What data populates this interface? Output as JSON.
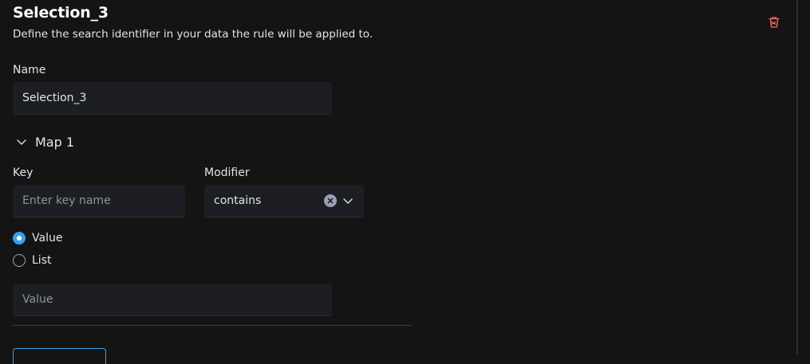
{
  "header": {
    "title": "Selection_3",
    "description": "Define the search identifier in your data the rule will be applied to."
  },
  "name_field": {
    "label": "Name",
    "value": "Selection_3"
  },
  "map": {
    "label": "Map 1",
    "expanded": true
  },
  "key_field": {
    "label": "Key",
    "placeholder": "Enter key name",
    "value": ""
  },
  "modifier_field": {
    "label": "Modifier",
    "value": "contains"
  },
  "value_type": {
    "options": [
      {
        "label": "Value",
        "checked": true
      },
      {
        "label": "List",
        "checked": false
      }
    ]
  },
  "value_field": {
    "placeholder": "Value",
    "value": ""
  },
  "icons": {
    "delete": "trash-icon",
    "collapse": "chevron-down-icon",
    "clear": "clear-icon",
    "dropdown": "caret-down-icon"
  },
  "colors": {
    "background": "#141414",
    "field": "#1d1e24",
    "accent": "#36a2ef",
    "danger": "#f86b63",
    "text": "#dfe5ef"
  }
}
